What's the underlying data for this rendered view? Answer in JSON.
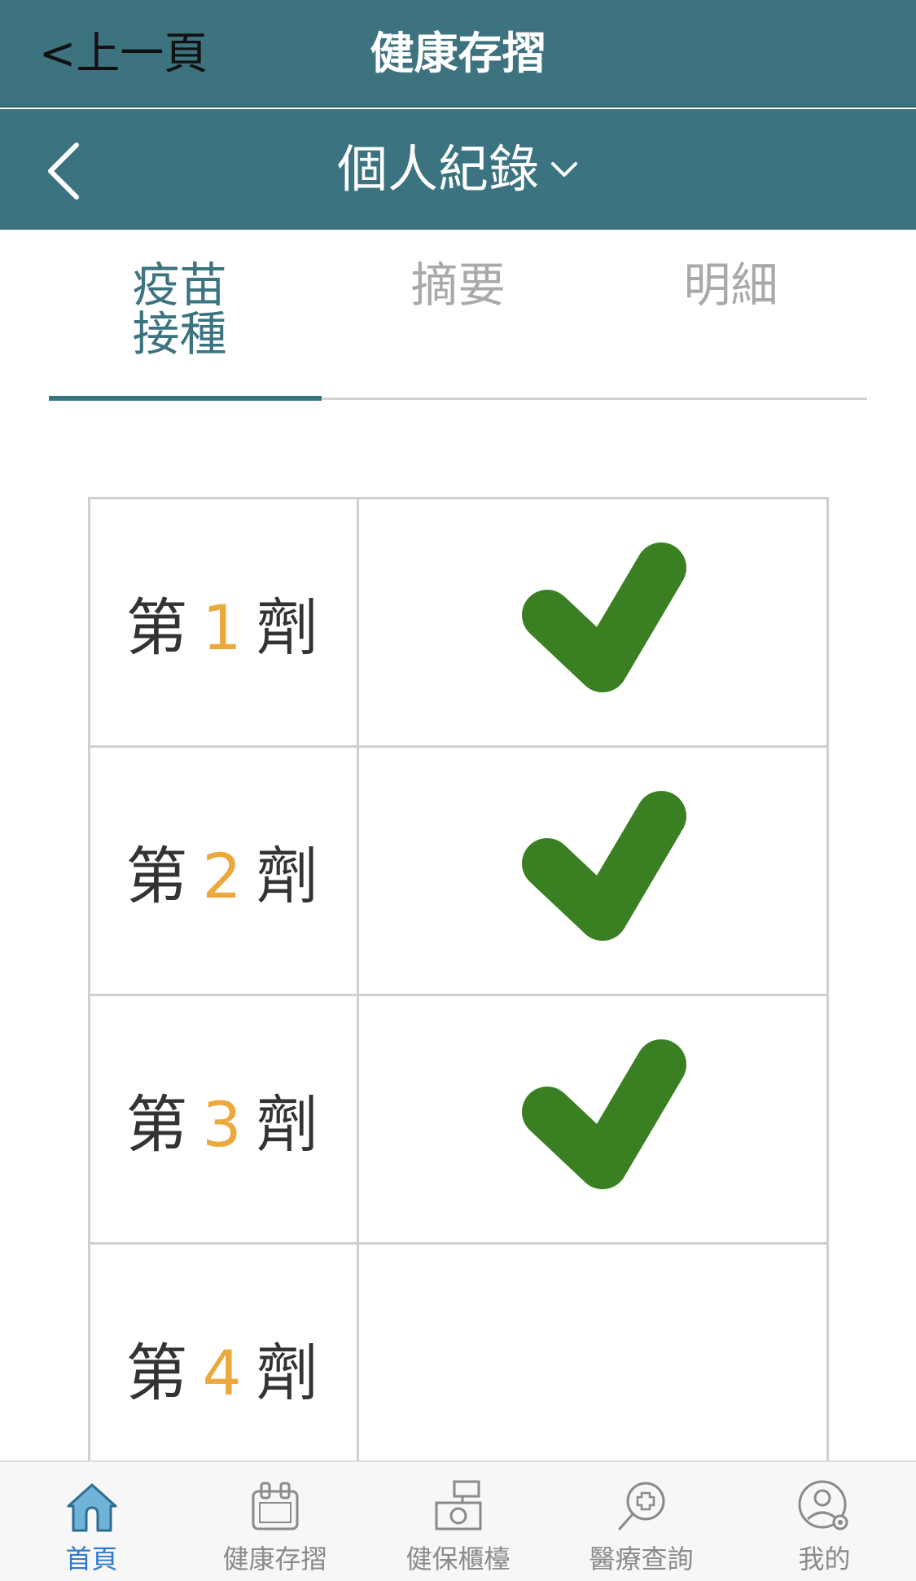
{
  "header": {
    "back_label": "<上一頁",
    "title": "健康存摺"
  },
  "subheader": {
    "title": "個人紀錄"
  },
  "tabs": [
    {
      "label": "疫苗接種",
      "active": true
    },
    {
      "label": "摘要",
      "active": false
    },
    {
      "label": "明細",
      "active": false
    }
  ],
  "doses": [
    {
      "prefix": "第",
      "number": "1",
      "suffix": "劑",
      "completed": true
    },
    {
      "prefix": "第",
      "number": "2",
      "suffix": "劑",
      "completed": true
    },
    {
      "prefix": "第",
      "number": "3",
      "suffix": "劑",
      "completed": true
    },
    {
      "prefix": "第",
      "number": "4",
      "suffix": "劑",
      "completed": false
    }
  ],
  "bottom_nav": [
    {
      "label": "首頁",
      "icon": "home-icon",
      "active": true
    },
    {
      "label": "健康存摺",
      "icon": "health-passbook-icon",
      "active": false
    },
    {
      "label": "健保櫃檯",
      "icon": "nhi-counter-icon",
      "active": false
    },
    {
      "label": "醫療查詢",
      "icon": "medical-search-icon",
      "active": false
    },
    {
      "label": "我的",
      "icon": "profile-settings-icon",
      "active": false
    }
  ],
  "colors": {
    "header_bg": "#3d727f",
    "accent": "#3b7480",
    "dose_number": "#eba93d",
    "check": "#3a8022",
    "nav_active": "#2f7bd1"
  }
}
